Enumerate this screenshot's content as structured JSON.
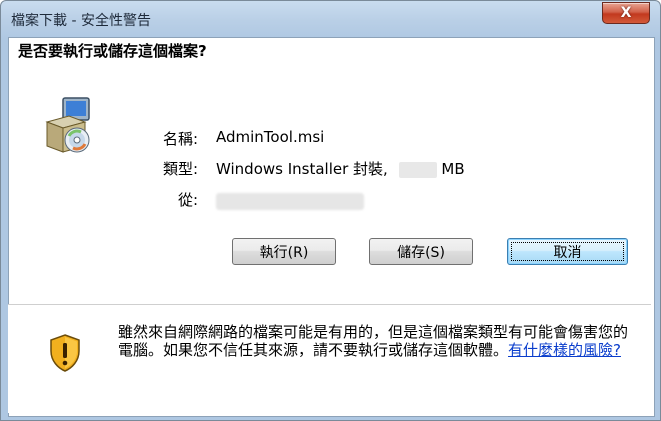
{
  "window": {
    "title": "檔案下載 - 安全性警告",
    "close_symbol": "X"
  },
  "dialog": {
    "question": "是否要執行或儲存這個檔案?",
    "file_icon": "installer-package-icon",
    "fields": {
      "name_label": "名稱:",
      "name_value": "AdminTool.msi",
      "type_label": "類型:",
      "type_value": "Windows Installer 封裝,",
      "type_unit": "MB",
      "from_label": "從:"
    },
    "buttons": {
      "run": "執行(R)",
      "save": "儲存(S)",
      "cancel": "取消"
    }
  },
  "footer": {
    "warning_icon": "security-shield-warning-icon",
    "warning_text": "雖然來自網際網路的檔案可能是有用的，但是這個檔案類型有可能會傷害您的電腦。如果您不信任其來源，請不要執行或儲存這個軟體。",
    "risk_link": "有什麼樣的風險?"
  },
  "colors": {
    "titlebar": "#b9cfe6",
    "close_button": "#c2391f",
    "link": "#0a3dcc"
  }
}
